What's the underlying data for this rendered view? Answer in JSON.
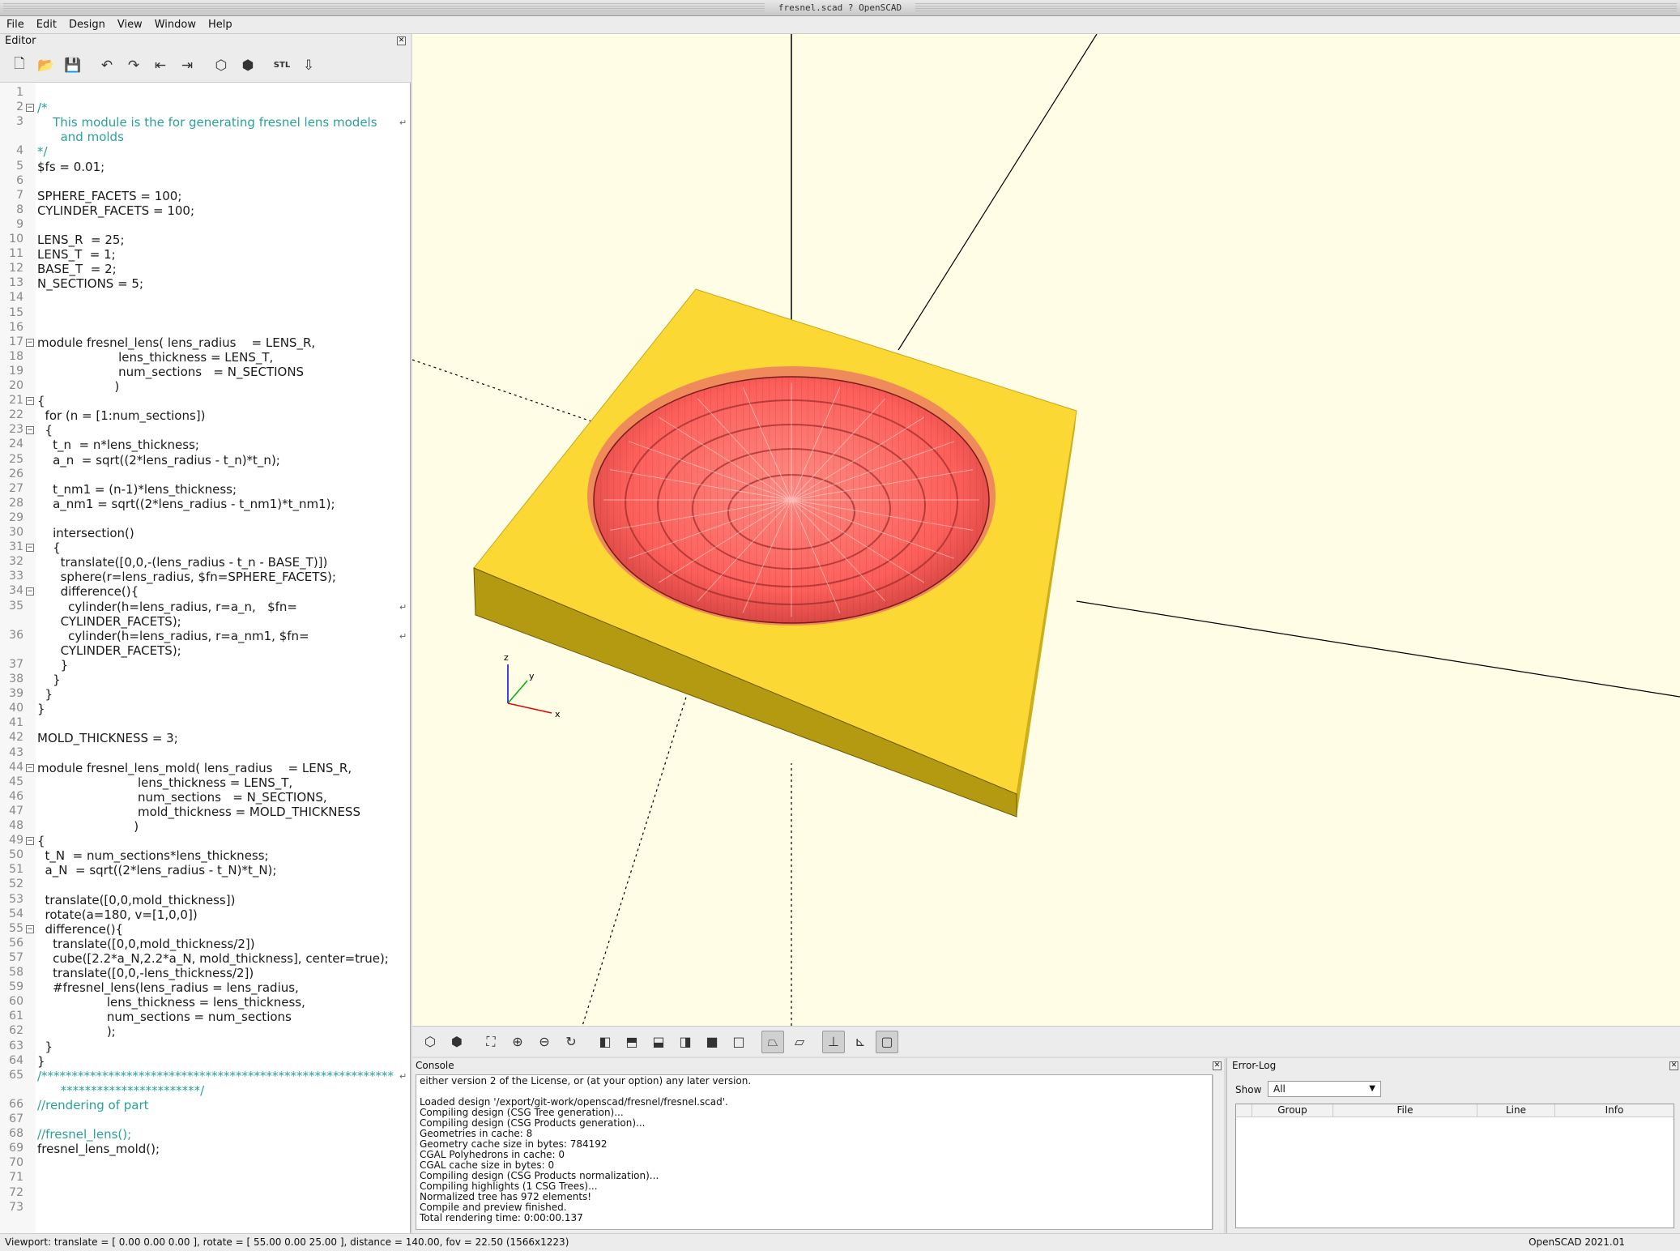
{
  "window": {
    "title": "fresnel.scad ? OpenSCAD"
  },
  "menu": [
    "File",
    "Edit",
    "Design",
    "View",
    "Window",
    "Help"
  ],
  "editor": {
    "title": "Editor",
    "toolbar_icons": [
      "new-file-icon",
      "open-file-icon",
      "save-file-icon",
      "undo-icon",
      "redo-icon",
      "unindent-icon",
      "indent-icon",
      "preview-icon",
      "render-icon",
      "export-stl-icon",
      "send-to-3d-print-icon"
    ],
    "lines": [
      {
        "n": "1",
        "t": ""
      },
      {
        "n": "2",
        "t": "/*"
      },
      {
        "n": "3",
        "t": "    This module is the for generating fresnel lens models"
      },
      {
        "n": "",
        "t": "      and molds"
      },
      {
        "n": "4",
        "t": "*/"
      },
      {
        "n": "5",
        "t": "$fs = 0.01;"
      },
      {
        "n": "6",
        "t": ""
      },
      {
        "n": "7",
        "t": "SPHERE_FACETS = 100;"
      },
      {
        "n": "8",
        "t": "CYLINDER_FACETS = 100;"
      },
      {
        "n": "9",
        "t": ""
      },
      {
        "n": "10",
        "t": "LENS_R  = 25;"
      },
      {
        "n": "11",
        "t": "LENS_T  = 1;"
      },
      {
        "n": "12",
        "t": "BASE_T  = 2;"
      },
      {
        "n": "13",
        "t": "N_SECTIONS = 5;"
      },
      {
        "n": "14",
        "t": ""
      },
      {
        "n": "15",
        "t": ""
      },
      {
        "n": "16",
        "t": ""
      },
      {
        "n": "17",
        "t": "module fresnel_lens( lens_radius    = LENS_R,"
      },
      {
        "n": "18",
        "t": "                     lens_thickness = LENS_T,"
      },
      {
        "n": "19",
        "t": "                     num_sections   = N_SECTIONS"
      },
      {
        "n": "20",
        "t": "                    )"
      },
      {
        "n": "21",
        "t": "{"
      },
      {
        "n": "22",
        "t": "  for (n = [1:num_sections])"
      },
      {
        "n": "23",
        "t": "  {"
      },
      {
        "n": "24",
        "t": "    t_n  = n*lens_thickness;"
      },
      {
        "n": "25",
        "t": "    a_n  = sqrt((2*lens_radius - t_n)*t_n);"
      },
      {
        "n": "26",
        "t": ""
      },
      {
        "n": "27",
        "t": "    t_nm1 = (n-1)*lens_thickness;"
      },
      {
        "n": "28",
        "t": "    a_nm1 = sqrt((2*lens_radius - t_nm1)*t_nm1);"
      },
      {
        "n": "29",
        "t": ""
      },
      {
        "n": "30",
        "t": "    intersection()"
      },
      {
        "n": "31",
        "t": "    {"
      },
      {
        "n": "32",
        "t": "      translate([0,0,-(lens_radius - t_n - BASE_T)])"
      },
      {
        "n": "33",
        "t": "      sphere(r=lens_radius, $fn=SPHERE_FACETS);"
      },
      {
        "n": "34",
        "t": "      difference(){"
      },
      {
        "n": "35",
        "t": "        cylinder(h=lens_radius, r=a_n,   $fn="
      },
      {
        "n": "",
        "t": "      CYLINDER_FACETS);"
      },
      {
        "n": "36",
        "t": "        cylinder(h=lens_radius, r=a_nm1, $fn="
      },
      {
        "n": "",
        "t": "      CYLINDER_FACETS);"
      },
      {
        "n": "37",
        "t": "      }"
      },
      {
        "n": "38",
        "t": "    }"
      },
      {
        "n": "39",
        "t": "  }"
      },
      {
        "n": "40",
        "t": "}"
      },
      {
        "n": "41",
        "t": ""
      },
      {
        "n": "42",
        "t": "MOLD_THICKNESS = 3;"
      },
      {
        "n": "43",
        "t": ""
      },
      {
        "n": "44",
        "t": "module fresnel_lens_mold( lens_radius    = LENS_R,"
      },
      {
        "n": "45",
        "t": "                          lens_thickness = LENS_T,"
      },
      {
        "n": "46",
        "t": "                          num_sections   = N_SECTIONS,"
      },
      {
        "n": "47",
        "t": "                          mold_thickness = MOLD_THICKNESS"
      },
      {
        "n": "48",
        "t": "                         )"
      },
      {
        "n": "49",
        "t": "{"
      },
      {
        "n": "50",
        "t": "  t_N  = num_sections*lens_thickness;"
      },
      {
        "n": "51",
        "t": "  a_N  = sqrt((2*lens_radius - t_N)*t_N);"
      },
      {
        "n": "52",
        "t": ""
      },
      {
        "n": "53",
        "t": "  translate([0,0,mold_thickness])"
      },
      {
        "n": "54",
        "t": "  rotate(a=180, v=[1,0,0])"
      },
      {
        "n": "55",
        "t": "  difference(){"
      },
      {
        "n": "56",
        "t": "    translate([0,0,mold_thickness/2])"
      },
      {
        "n": "57",
        "t": "    cube([2.2*a_N,2.2*a_N, mold_thickness], center=true);"
      },
      {
        "n": "58",
        "t": "    translate([0,0,-lens_thickness/2])"
      },
      {
        "n": "59",
        "t": "    #fresnel_lens(lens_radius = lens_radius,"
      },
      {
        "n": "60",
        "t": "                  lens_thickness = lens_thickness,"
      },
      {
        "n": "61",
        "t": "                  num_sections = num_sections"
      },
      {
        "n": "62",
        "t": "                  );"
      },
      {
        "n": "63",
        "t": "  }"
      },
      {
        "n": "64",
        "t": "}"
      },
      {
        "n": "65",
        "t": "/**********************************************************"
      },
      {
        "n": "",
        "t": "      ***********************/"
      },
      {
        "n": "66",
        "t": "//rendering of part"
      },
      {
        "n": "67",
        "t": ""
      },
      {
        "n": "68",
        "t": "//fresnel_lens();"
      },
      {
        "n": "69",
        "t": "fresnel_lens_mold();"
      },
      {
        "n": "70",
        "t": ""
      },
      {
        "n": "71",
        "t": ""
      },
      {
        "n": "72",
        "t": ""
      },
      {
        "n": "73",
        "t": ""
      }
    ]
  },
  "viewport": {
    "base_color": "#f9d72f",
    "lens_color": "#ff6060",
    "background": "#fffde6",
    "axis_labels": {
      "x": "x",
      "y": "y",
      "z": "z"
    }
  },
  "view_toolbar_icons": [
    "preview-icon",
    "render-icon",
    "view-all-icon",
    "zoom-in-icon",
    "zoom-out-icon",
    "reset-view-icon",
    "view-right-icon",
    "view-top-icon",
    "view-bottom-icon",
    "view-left-icon",
    "view-front-icon",
    "view-back-icon",
    "perspective-icon",
    "orthogonal-icon",
    "show-axes-icon",
    "show-scale-icon",
    "show-edges-icon"
  ],
  "console": {
    "title": "Console",
    "lines": [
      "either version 2 of the License, or (at your option) any later version.",
      "",
      "Loaded design '/export/git-work/openscad/fresnel/fresnel.scad'.",
      "Compiling design (CSG Tree generation)...",
      "Compiling design (CSG Products generation)...",
      "Geometries in cache: 8",
      "Geometry cache size in bytes: 784192",
      "CGAL Polyhedrons in cache: 0",
      "CGAL cache size in bytes: 0",
      "Compiling design (CSG Products normalization)...",
      "Compiling highlights (1 CSG Trees)...",
      "Normalized tree has 972 elements!",
      "Compile and preview finished.",
      "Total rendering time: 0:00:00.137"
    ]
  },
  "errorlog": {
    "title": "Error-Log",
    "show_label": "Show",
    "show_value": "All",
    "columns": [
      "Group",
      "File",
      "Line",
      "Info"
    ]
  },
  "status": {
    "viewport": "Viewport: translate = [ 0.00 0.00 0.00 ], rotate = [ 55.00 0.00 25.00 ], distance = 140.00, fov = 22.50 (1566x1223)",
    "version": "OpenSCAD 2021.01"
  }
}
